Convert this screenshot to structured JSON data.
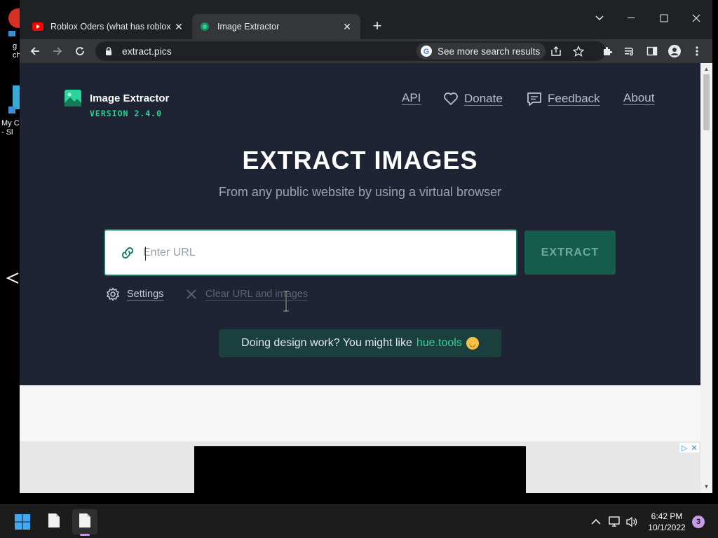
{
  "desktop": {
    "icons": [
      {
        "label": "g\nch"
      },
      {
        "label": "My C\n- Sl"
      }
    ]
  },
  "browser": {
    "tabs": [
      {
        "title": "Roblox Oders (what has roblox b",
        "favicon": "youtube-icon",
        "active": false
      },
      {
        "title": "Image Extractor",
        "favicon": "image-extractor-favicon",
        "active": true
      }
    ],
    "address": "extract.pics",
    "search_chip": "See more search results"
  },
  "page": {
    "brand": {
      "name": "Image Extractor",
      "version": "VERSION 2.4.0"
    },
    "nav": [
      {
        "label": "API"
      },
      {
        "label": "Donate",
        "icon": "heart-icon"
      },
      {
        "label": "Feedback",
        "icon": "chat-icon"
      },
      {
        "label": "About"
      }
    ],
    "hero": {
      "title": "EXTRACT IMAGES",
      "subtitle": "From any public website by using a virtual browser"
    },
    "url_input": {
      "placeholder": "Enter URL",
      "value": ""
    },
    "extract_button": "EXTRACT",
    "settings_label": "Settings",
    "clear_label": "Clear URL and images",
    "promo": {
      "text": "Doing design work? You might like",
      "link": "hue.tools",
      "emoji": "smiling-face-icon"
    }
  },
  "taskbar": {
    "time": "6:42 PM",
    "date": "10/1/2022",
    "notification_count": "3"
  },
  "colors": {
    "hero_bg": "#1e2433",
    "accent_green": "#2bd49b",
    "extract_button_bg": "#155d4a"
  }
}
